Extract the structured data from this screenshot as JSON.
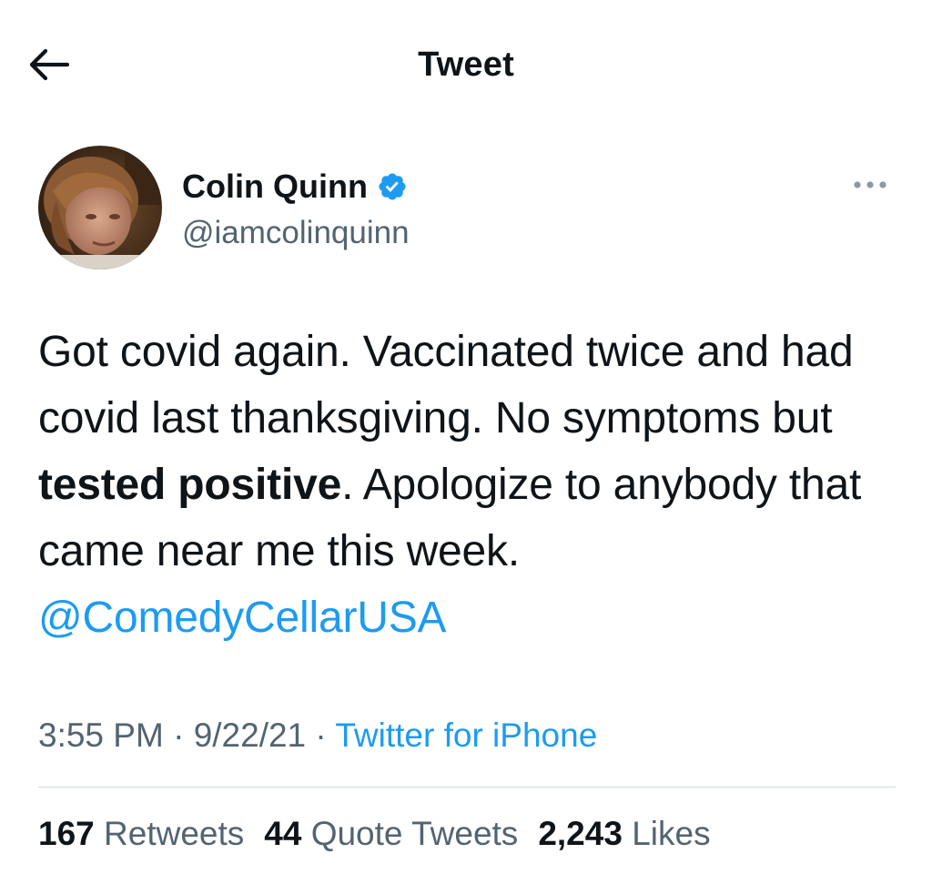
{
  "header": {
    "title": "Tweet",
    "back_icon": "arrow-left-icon"
  },
  "author": {
    "name": "Colin Quinn",
    "handle": "@iamcolinquinn",
    "verified_icon": "verified-badge-icon",
    "verified_color": "#1d9bf0",
    "more_icon": "more-dots-icon"
  },
  "tweet": {
    "text_before_bold": "Got covid again. Vaccinated twice and had covid last thanksgiving. No symptoms but ",
    "bold_text": "tested positive",
    "text_after_bold": ". Apologize to anybody that came near me this week. ",
    "mention": "@ComedyCellarUSA"
  },
  "meta": {
    "time": "3:55 PM",
    "sep1": " · ",
    "date": "9/22/21",
    "sep2": " · ",
    "source": "Twitter for iPhone"
  },
  "stats": {
    "retweets_count": "167",
    "retweets_label": "Retweets",
    "quotes_count": "44",
    "quotes_label": "Quote Tweets",
    "likes_count": "2,243",
    "likes_label": "Likes"
  },
  "colors": {
    "link": "#1d9bf0",
    "secondary_text": "#536471",
    "primary_text": "#0f1419"
  }
}
